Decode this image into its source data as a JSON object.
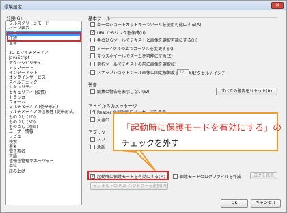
{
  "window": {
    "title": "環境設定",
    "close_glyph": "✕"
  },
  "categories": {
    "label": "分類(G):",
    "items": [
      "フルスクリーンモード",
      "ページ表示",
      "一般",
      "注釈",
      "文書",
      "",
      "3D とマルチメディア",
      "JavaScript",
      "アクセシビリティ",
      "アップデート",
      "インターネット",
      "オンラインサービス",
      "スペルチェック",
      "セキュリティ",
      "セキュリティ (拡張)",
      "トラッカー",
      "フォーム",
      "マルチメディア (従来形式)",
      "マルチメディアの信頼性 (従来形式)",
      "ものさし (2D)",
      "ものさし (3D)",
      "ものさし (地図)",
      "ユーザー情報",
      "レビュー",
      "検索",
      "署名",
      "電子署名",
      "言語",
      "信頼性管理マネージャー",
      "単位",
      "読み上げ"
    ],
    "selected_index": 2
  },
  "basic_tools": {
    "title": "基本ツール",
    "options": [
      {
        "label": "単一のショートカットキーでツールを使用可能にする(A)",
        "checked": false
      },
      {
        "label": "URL からリンクを作成(U)",
        "checked": true
      },
      {
        "label": "手のひらツールでテキストと画像を選択可能にする(H)",
        "checked": false
      },
      {
        "label": "アーティクルの上でカーソルを変更する(I)",
        "checked": true
      },
      {
        "label": "マウスホイールでズームを可能にする(Z)",
        "checked": false
      },
      {
        "label": "選択ツールでテキストの前に画像を選択(E)",
        "checked": false
      },
      {
        "label": "スナップショットツール画像に固定解像度を使用(S):",
        "checked": false
      }
    ],
    "resolution_value": "72",
    "resolution_unit": "ピクセル / インチ"
  },
  "warnings": {
    "title": "警告",
    "option": {
      "label": "編集の警告を表示しない(W)",
      "checked": false
    },
    "reset_button": "すべての警告をリセット(R)"
  },
  "app_messages": {
    "title": "アドビからのメッセージ",
    "options": [
      {
        "label": "Reader の起動時にメッセージを表示",
        "checked": true
      },
      {
        "label": "文書の",
        "checked": false
      }
    ]
  },
  "app_startup": {
    "title": "アプリケ",
    "options": [
      {
        "label": "スプ",
        "checked": false
      },
      {
        "label": "承認",
        "checked": false
      }
    ]
  },
  "protected_mode": {
    "option": {
      "label": "起動時に保護モードを有効にする(M)",
      "checked": true
    },
    "log_option": {
      "label": "保護モードのログファイルを作成",
      "checked": false
    },
    "log_button": "ログを表示",
    "default_pdf_button": "デフォルトの PDF ハンドラーを選択(P)"
  },
  "callout": {
    "line1": "「起動時に保護モードを有効にする」の",
    "line2": "チェックを外す",
    "border_color": "#f29a2e",
    "text_color": "#e3322a"
  },
  "footer": {
    "ok": "OK",
    "cancel": "キャンセル"
  }
}
